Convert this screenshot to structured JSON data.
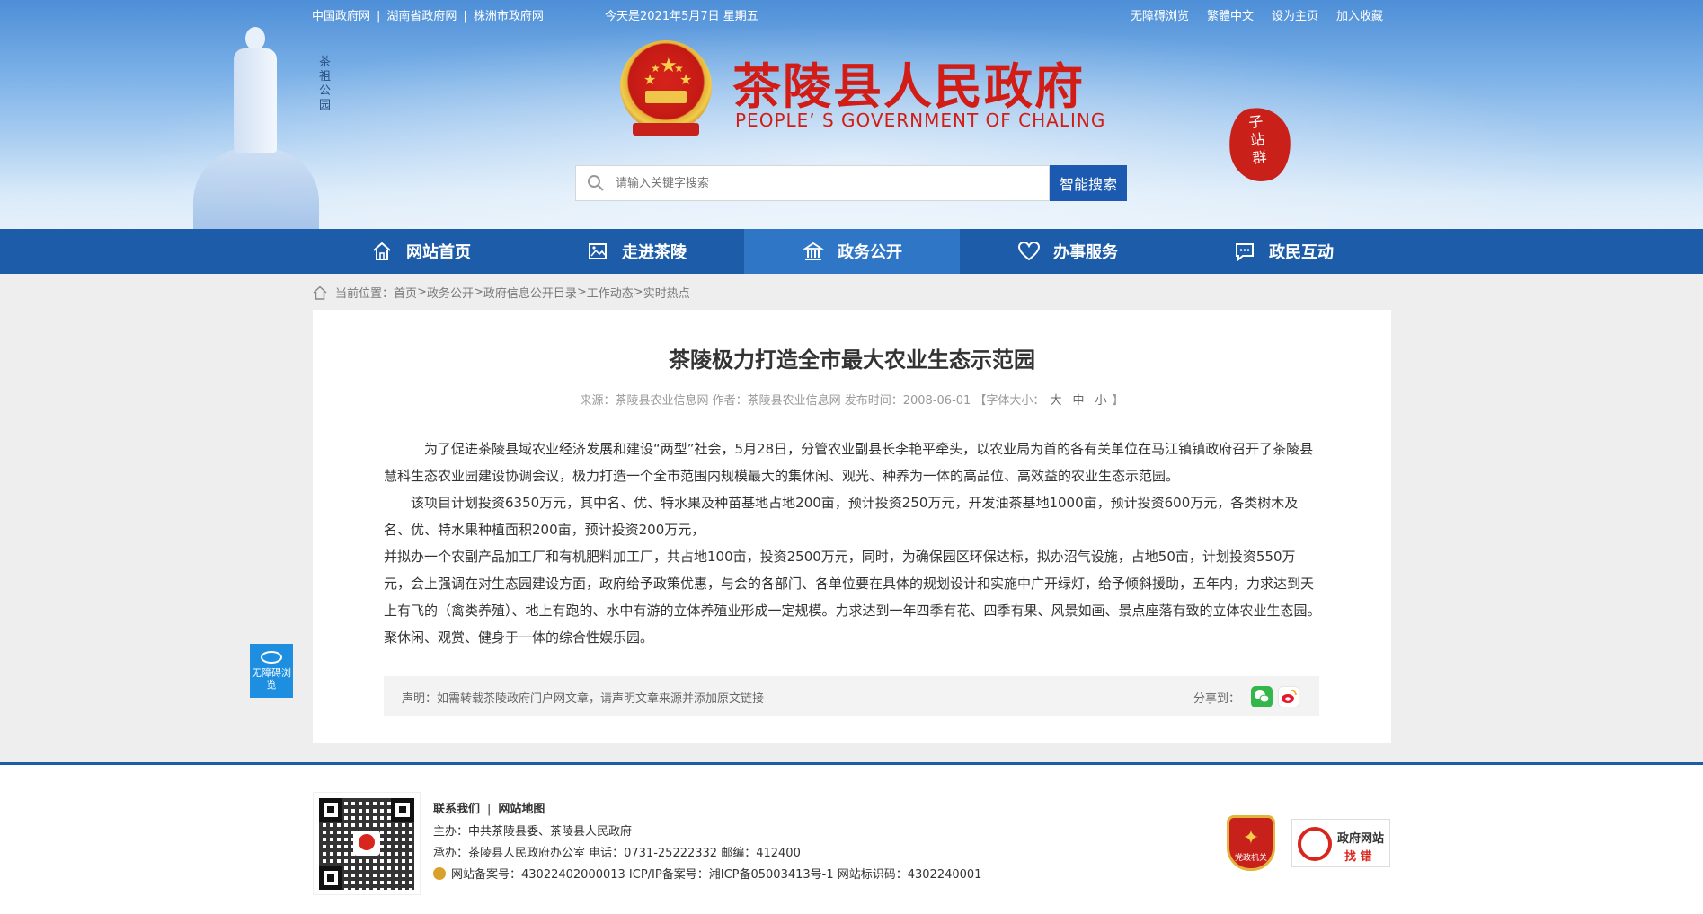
{
  "header": {
    "links": [
      "中国政府网",
      "湖南省政府网",
      "株洲市政府网"
    ],
    "date": "今天是2021年5月7日 星期五",
    "right_links": [
      "无障碍浏览",
      "繁體中文",
      "设为主页",
      "加入收藏"
    ],
    "park_label": "茶祖公园",
    "title": "茶陵县人民政府",
    "subtitle": "PEOPLE’ S GOVERNMENT OF CHALING",
    "subsites_label": "子站群"
  },
  "search": {
    "placeholder": "请输入关键字搜索",
    "button": "智能搜索"
  },
  "nav": [
    {
      "label": "网站首页",
      "icon": "home-icon"
    },
    {
      "label": "走进茶陵",
      "icon": "image-icon"
    },
    {
      "label": "政务公开",
      "icon": "government-building-icon",
      "active": true
    },
    {
      "label": "办事服务",
      "icon": "heart-icon"
    },
    {
      "label": "政民互动",
      "icon": "chat-icon"
    }
  ],
  "breadcrumb": {
    "prefix": "当前位置：",
    "items": [
      "首页",
      "政务公开",
      "政府信息公开目录",
      "工作动态",
      "实时热点"
    ],
    "separator": " > "
  },
  "article": {
    "title": "茶陵极力打造全市最大农业生态示范园",
    "meta": "来源：茶陵县农业信息网 作者：茶陵县农业信息网 发布时间：2008-06-01 【字体大小：",
    "font_sizes": [
      "大",
      "中",
      "小"
    ],
    "meta_end": "】",
    "paragraphs": [
      "　　　为了促进茶陵县域农业经济发展和建设“两型”社会，5月28日，分管农业副县长李艳平牵头，以农业局为首的各有关单位在马江镇镇政府召开了茶陵县慧科生态农业园建设协调会议，极力打造一个全市范围内规模最大的集休闲、观光、种养为一体的高品位、高效益的农业生态示范园。",
      "　　该项目计划投资6350万元，其中名、优、特水果及种苗基地占地200亩，预计投资250万元，开发油茶基地1000亩，预计投资600万元，各类树木及名、优、特水果种植面积200亩，预计投资200万元，",
      "并拟办一个农副产品加工厂和有机肥料加工厂，共占地100亩，投资2500万元，同时，为确保园区环保达标，拟办沼气设施，占地50亩，计划投资550万元，会上强调在对生态园建设方面，政府给予政策优惠，与会的各部门、各单位要在具体的规划设计和实施中广开绿灯，给予倾斜援助，五年内，力求达到天上有飞的（禽类养殖）、地上有跑的、水中有游的立体养殖业形成一定规模。力求达到一年四季有花、四季有果、风景如画、景点座落有致的立体农业生态园。聚休闲、观赏、健身于一体的综合性娱乐园。"
    ],
    "statement": "声明：如需转载茶陵政府门户网文章，请声明文章来源并添加原文链接",
    "share_label": "分享到："
  },
  "float_access": "无障碍浏览",
  "footer": {
    "links": [
      "联系我们",
      "网站地图"
    ],
    "host": "主办：中共茶陵县委、茶陵县人民政府",
    "organizer": "承办：茶陵县人民政府办公室 电话：0731-25222332 邮编：412400",
    "record": "网站备案号：430224020000​13 ICP/IP备案号：湘ICP备05003413号-1 网站标识码：4302240001",
    "party_badge": "党政机关",
    "error_badge_1": "政府网站",
    "error_badge_2": "找 错"
  },
  "colors": {
    "nav_bg": "#1d5ca9",
    "nav_active": "#2f76c6",
    "title_red": "#d21d16",
    "search_button": "#1b5ab0"
  }
}
